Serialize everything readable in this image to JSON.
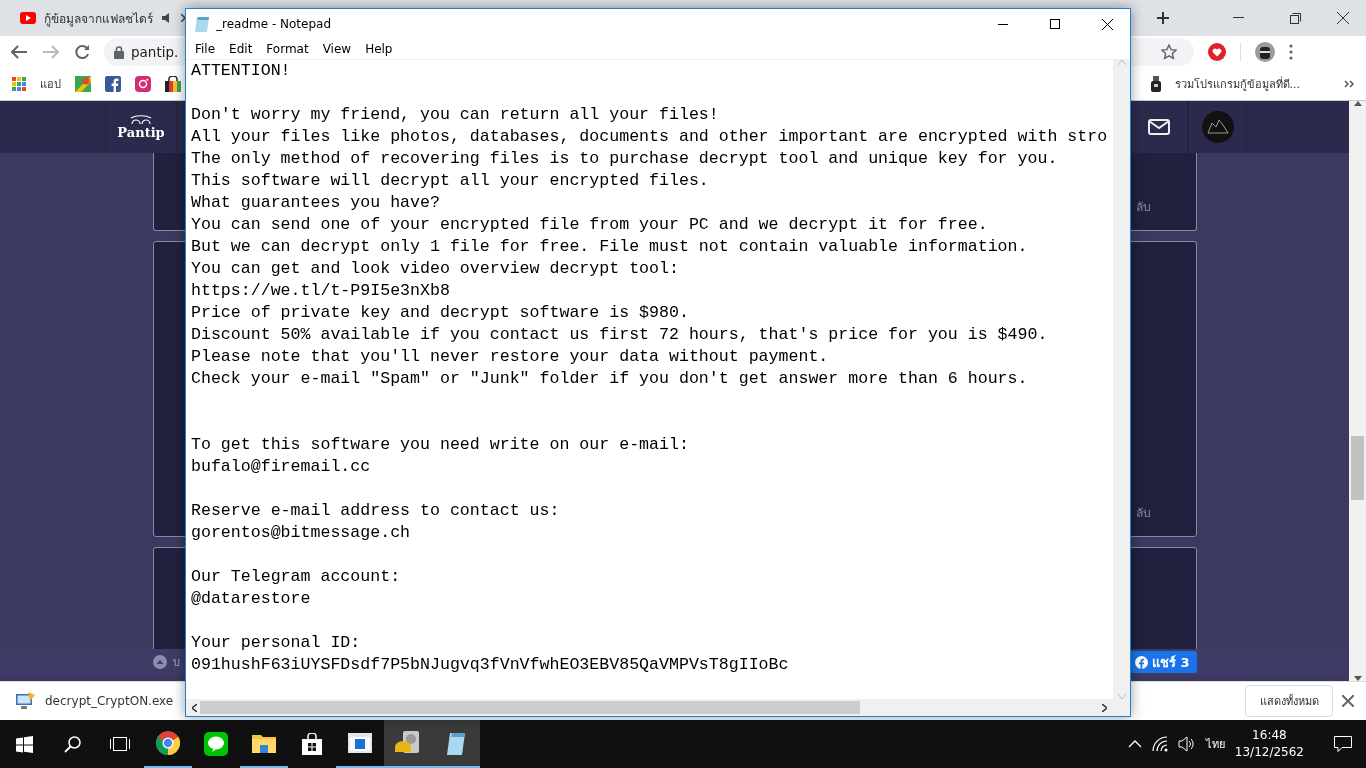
{
  "browser": {
    "tab_title": "กู้ข้อมูลจากแฟลชไดร์",
    "address": "pantip.",
    "apps_label": "แอป",
    "bookmark": "รวมโปรแกรมกู้ข้อมูลที่ดี..."
  },
  "site": {
    "logo": "Pantip",
    "card_links": [
      "ลับ",
      "ลับ"
    ],
    "footer_text": "บ",
    "share": "แชร์ 3"
  },
  "downloads": {
    "file": "decrypt_CryptON.exe",
    "show_all": "แสดงทั้งหมด"
  },
  "notepad": {
    "title": "_readme - Notepad",
    "menu": [
      "File",
      "Edit",
      "Format",
      "View",
      "Help"
    ],
    "lines": [
      {
        "kind": "text",
        "text": "ATTENTION!"
      },
      {
        "kind": "blank"
      },
      {
        "kind": "text",
        "text": "Don't worry my friend, you can return all your files!"
      },
      {
        "kind": "text",
        "text": "All your files like photos, databases, documents and other important are encrypted with stro"
      },
      {
        "kind": "text",
        "text": "The only method of recovering files is to purchase decrypt tool and unique key for you."
      },
      {
        "kind": "text",
        "text": "This software will decrypt all your encrypted files."
      },
      {
        "kind": "text",
        "text": "What guarantees you have?"
      },
      {
        "kind": "text",
        "text": "You can send one of your encrypted file from your PC and we decrypt it for free."
      },
      {
        "kind": "text",
        "text": "But we can decrypt only 1 file for free. File must not contain valuable information."
      },
      {
        "kind": "text",
        "text": "You can get and look video overview decrypt tool:"
      },
      {
        "kind": "text",
        "text": "https://we.tl/t-P9I5e3nXb8"
      },
      {
        "kind": "text",
        "text": "Price of private key and decrypt software is $980."
      },
      {
        "kind": "text",
        "text": "Discount 50% available if you contact us first 72 hours, that's price for you is $490."
      },
      {
        "kind": "text",
        "text": "Please note that you'll never restore your data without payment."
      },
      {
        "kind": "text",
        "text": "Check your e-mail \"Spam\" or \"Junk\" folder if you don't get answer more than 6 hours."
      },
      {
        "kind": "blank"
      },
      {
        "kind": "blank"
      },
      {
        "kind": "text",
        "text": "To get this software you need write on our e-mail:"
      },
      {
        "kind": "text",
        "text": "bufalo@firemail.cc"
      },
      {
        "kind": "blank"
      },
      {
        "kind": "text",
        "text": "Reserve e-mail address to contact us:"
      },
      {
        "kind": "text",
        "text": "gorentos@bitmessage.ch"
      },
      {
        "kind": "blank"
      },
      {
        "kind": "text",
        "text": "Our Telegram account:"
      },
      {
        "kind": "text",
        "text": "@datarestore"
      },
      {
        "kind": "blank"
      },
      {
        "kind": "text",
        "text": "Your personal ID:"
      },
      {
        "kind": "text",
        "text": "091hushF63iUYSFDsdf7P5bNJugvq3fVnVfwhEO3EBV85QaVMPVsT8gIIoBc"
      }
    ]
  },
  "taskbar": {
    "apps": [
      {
        "kind": "chrome",
        "running": true,
        "selected": false
      },
      {
        "kind": "line",
        "running": false,
        "selected": false
      },
      {
        "kind": "explorer",
        "running": true,
        "selected": false
      },
      {
        "kind": "store",
        "running": false,
        "selected": false
      },
      {
        "kind": "window",
        "running": true,
        "selected": false
      },
      {
        "kind": "drive",
        "running": true,
        "selected": true
      },
      {
        "kind": "notepad",
        "running": true,
        "selected": true
      }
    ],
    "language": "ไทย",
    "time": "16:48",
    "date": "13/12/2562"
  }
}
